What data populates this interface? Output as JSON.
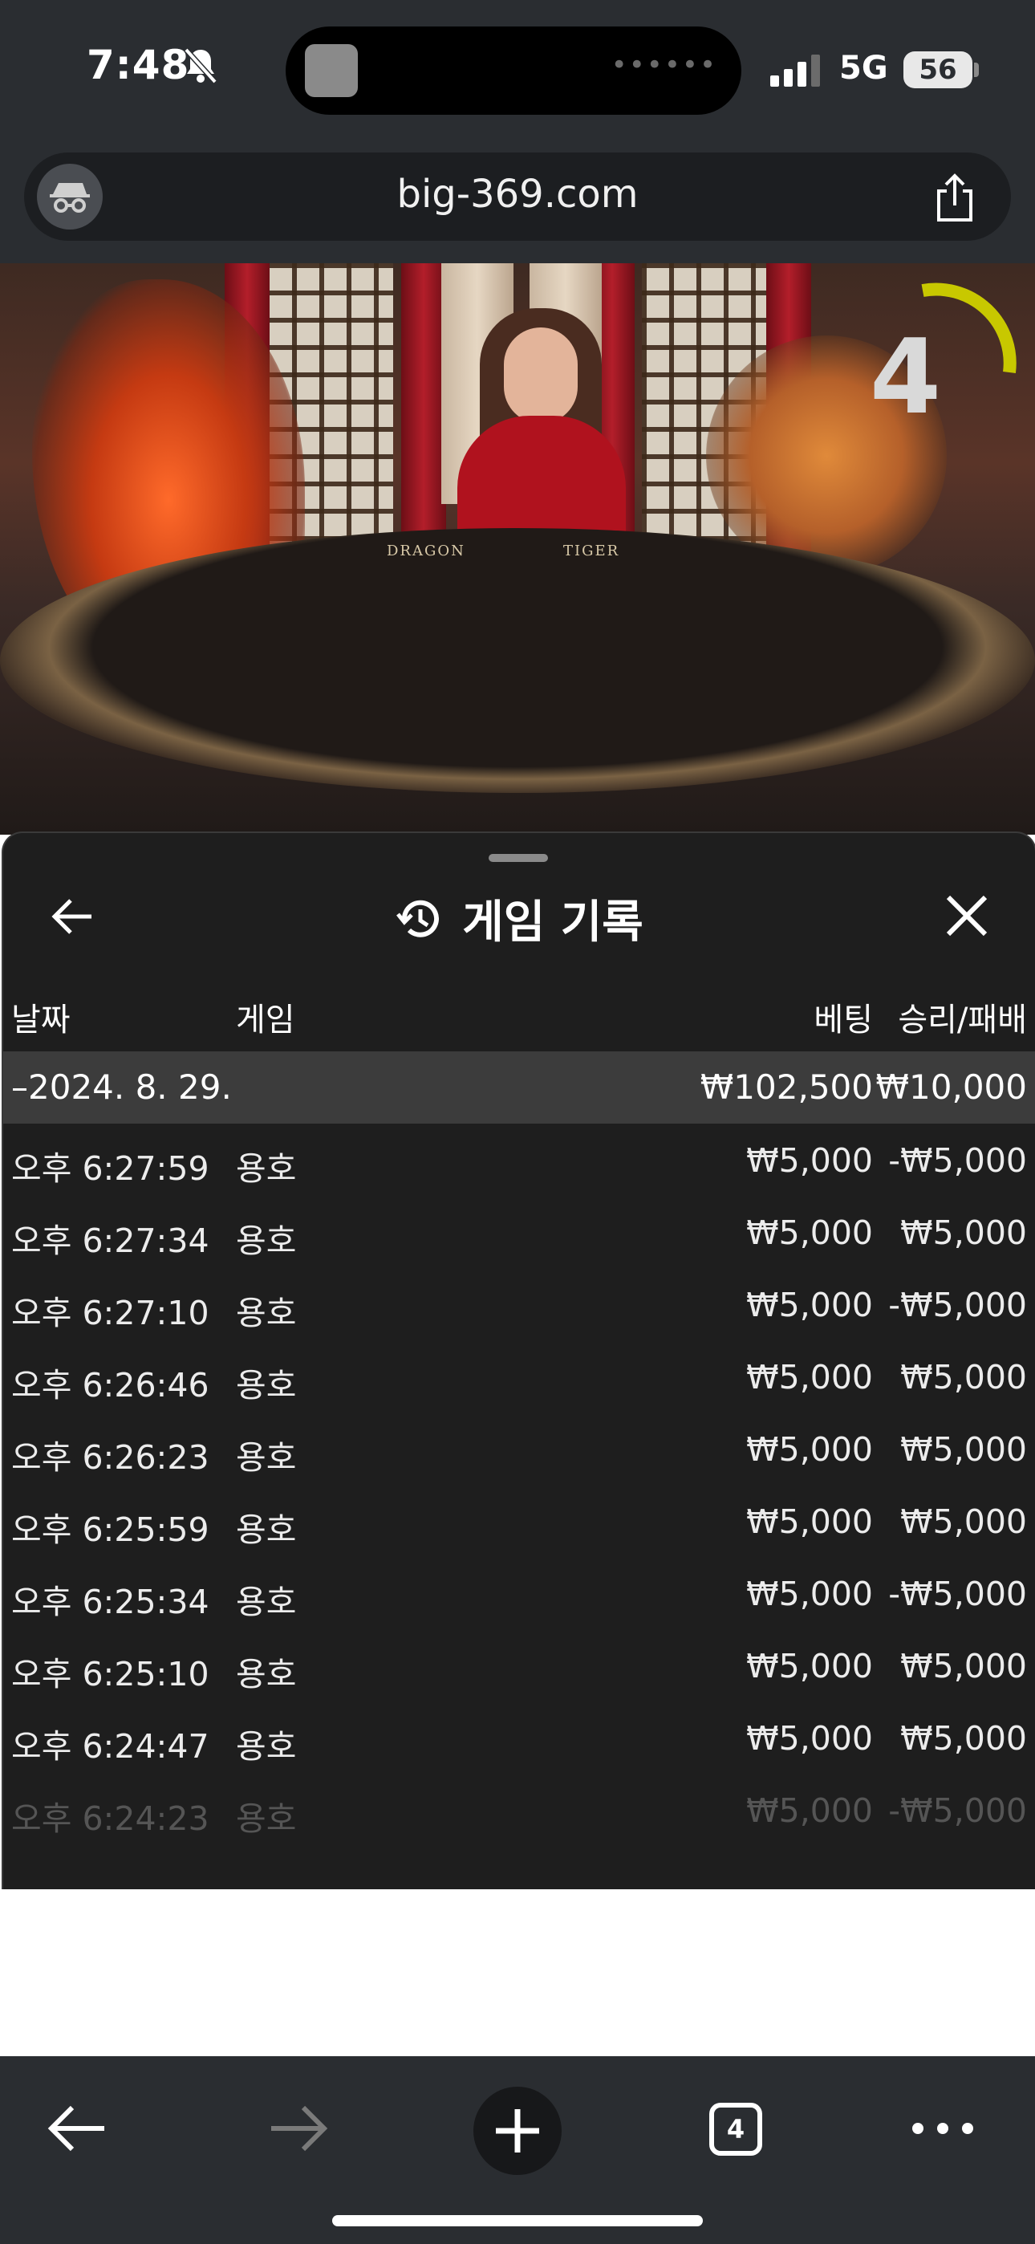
{
  "status_bar": {
    "time": "7:48",
    "network": "5G",
    "battery": "56"
  },
  "browser": {
    "url": "big-369.com",
    "tab_count": "4"
  },
  "video": {
    "table_left_label": "DRAGON",
    "table_right_label": "TIGER",
    "countdown": "4"
  },
  "history": {
    "title": "게임 기록",
    "columns": {
      "date": "날짜",
      "game": "게임",
      "bet": "베팅",
      "win_loss": "승리/패배"
    },
    "date_group": {
      "date": "–2024. 8. 29.",
      "bet_total": "₩102,500",
      "win_total": "₩10,000"
    },
    "rows": [
      {
        "time": "오후 6:27:59",
        "game": "용호",
        "bet": "₩5,000",
        "result": "-₩5,000"
      },
      {
        "time": "오후 6:27:34",
        "game": "용호",
        "bet": "₩5,000",
        "result": "₩5,000"
      },
      {
        "time": "오후 6:27:10",
        "game": "용호",
        "bet": "₩5,000",
        "result": "-₩5,000"
      },
      {
        "time": "오후 6:26:46",
        "game": "용호",
        "bet": "₩5,000",
        "result": "₩5,000"
      },
      {
        "time": "오후 6:26:23",
        "game": "용호",
        "bet": "₩5,000",
        "result": "₩5,000"
      },
      {
        "time": "오후 6:25:59",
        "game": "용호",
        "bet": "₩5,000",
        "result": "₩5,000"
      },
      {
        "time": "오후 6:25:34",
        "game": "용호",
        "bet": "₩5,000",
        "result": "-₩5,000"
      },
      {
        "time": "오후 6:25:10",
        "game": "용호",
        "bet": "₩5,000",
        "result": "₩5,000"
      },
      {
        "time": "오후 6:24:47",
        "game": "용호",
        "bet": "₩5,000",
        "result": "₩5,000"
      },
      {
        "time": "오후 6:24:23",
        "game": "용호",
        "bet": "₩5,000",
        "result": "-₩5,000"
      }
    ]
  },
  "icons": {
    "status": [
      "bell-slash-icon",
      "signal-icon",
      "battery-icon"
    ],
    "browser": [
      "incognito-icon",
      "share-icon"
    ],
    "sheet": [
      "back-arrow-icon",
      "history-icon",
      "close-icon"
    ],
    "toolbar": [
      "back-icon",
      "forward-icon",
      "plus-icon",
      "tabs-icon",
      "more-icon"
    ]
  },
  "colors": {
    "chrome": "#2a2d31",
    "sheet": "#1e1e1e",
    "date_row": "#3c3c3c",
    "countdown_ring": "#c8c800"
  }
}
